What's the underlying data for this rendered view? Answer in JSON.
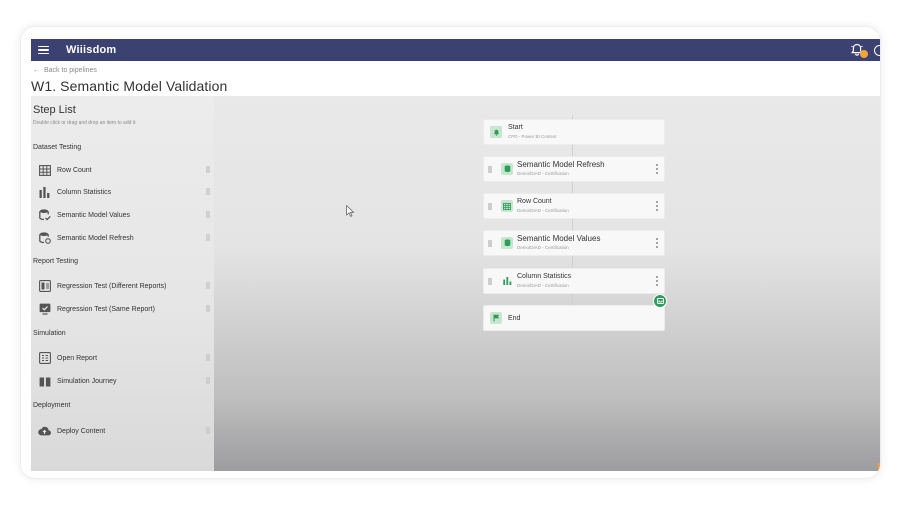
{
  "app": {
    "brand": "Wiiisdom"
  },
  "nav": {
    "back_label": "Back to pipelines",
    "back_arrow": "←"
  },
  "page": {
    "title": "W1. Semantic Model Validation"
  },
  "steplist": {
    "title": "Step List",
    "subtitle": "Double click or drag and drop an item to add it.",
    "sections": [
      {
        "label": "Dataset Testing",
        "items": [
          {
            "label": "Row Count",
            "icon": "table-icon"
          },
          {
            "label": "Column Statistics",
            "icon": "bar-chart-icon"
          },
          {
            "label": "Semantic Model Values",
            "icon": "database-check-icon"
          },
          {
            "label": "Semantic Model Refresh",
            "icon": "database-refresh-icon"
          }
        ]
      },
      {
        "label": "Report Testing",
        "items": [
          {
            "label": "Regression Test (Different Reports)",
            "icon": "report-compare-icon"
          },
          {
            "label": "Regression Test (Same Report)",
            "icon": "report-check-icon"
          }
        ]
      },
      {
        "label": "Simulation",
        "items": [
          {
            "label": "Open Report",
            "icon": "open-report-icon"
          },
          {
            "label": "Simulation Journey",
            "icon": "journey-icon"
          }
        ]
      },
      {
        "label": "Deployment",
        "items": [
          {
            "label": "Deploy Content",
            "icon": "cloud-upload-icon"
          }
        ]
      }
    ]
  },
  "pipeline": {
    "nodes": [
      {
        "kind": "start",
        "title": "Start",
        "subtitle": "CPD - Power BI Context",
        "icon": "bell-icon"
      },
      {
        "kind": "step",
        "title": "Semantic Model Refresh",
        "subtitle": "Demo/DIAD - Certification",
        "icon": "database-refresh-icon"
      },
      {
        "kind": "step",
        "title": "Row Count",
        "subtitle": "Demo/DIAD - Certification",
        "icon": "table-icon"
      },
      {
        "kind": "step",
        "title": "Semantic Model Values",
        "subtitle": "Demo/DIAD - Certification",
        "icon": "database-check-icon"
      },
      {
        "kind": "step",
        "title": "Column Statistics",
        "subtitle": "Demo/DIAD - Certification",
        "icon": "bar-chart-icon"
      },
      {
        "kind": "end",
        "title": "End",
        "subtitle": "",
        "icon": "flag-icon"
      }
    ]
  },
  "colors": {
    "topbar": "#3b4170",
    "accent_green": "#2e9d5c",
    "notification": "#f2a43a"
  }
}
